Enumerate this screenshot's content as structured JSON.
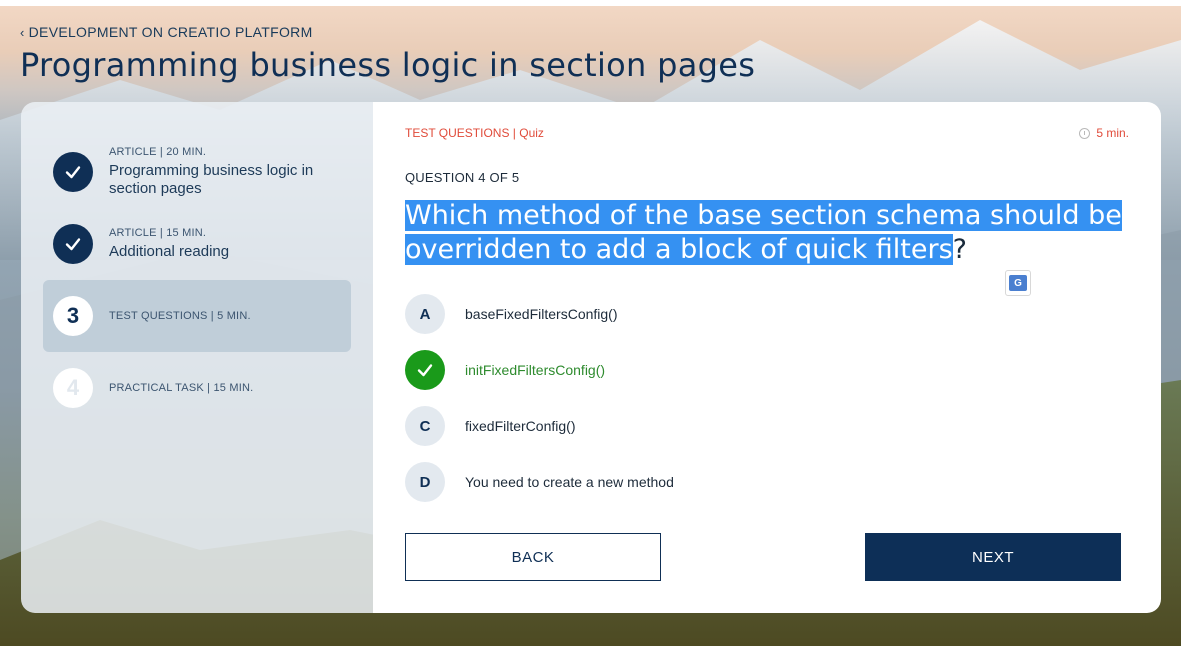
{
  "header": {
    "breadcrumb": "DEVELOPMENT ON CREATIO PLATFORM",
    "title": "Programming business logic in section pages"
  },
  "sidebar": {
    "steps": [
      {
        "meta": "ARTICLE | 20 MIN.",
        "title": "Programming business logic in section pages",
        "status": "done"
      },
      {
        "meta": "ARTICLE | 15 MIN.",
        "title": "Additional reading",
        "status": "done"
      },
      {
        "number": "3",
        "meta": "TEST QUESTIONS | 5 MIN.",
        "status": "current"
      },
      {
        "number": "4",
        "meta": "PRACTICAL TASK | 15 MIN.",
        "status": "pending"
      }
    ]
  },
  "quiz": {
    "label": "TEST QUESTIONS | Quiz",
    "timer": "5 min.",
    "question_count": "QUESTION 4 OF 5",
    "question_selected": "Which method of the base section schema should be overridden to add a block of quick filters",
    "question_rest": "?",
    "answers": [
      {
        "letter": "A",
        "text": "baseFixedFiltersConfig()",
        "correct": false
      },
      {
        "letter": "",
        "text": "initFixedFiltersConfig()",
        "correct": true
      },
      {
        "letter": "C",
        "text": "fixedFilterConfig()",
        "correct": false
      },
      {
        "letter": "D",
        "text": "You need to create a new method",
        "correct": false
      }
    ],
    "back_label": "BACK",
    "next_label": "NEXT"
  },
  "icons": {
    "breadcrumb": "chevron-left-icon",
    "timer": "clock-icon",
    "done": "check-icon",
    "translate": "translate-icon"
  },
  "colors": {
    "primary": "#0f2f55",
    "accent_red": "#e04b3a",
    "correct_green": "#1a9a1a",
    "selection": "#3591f2"
  }
}
